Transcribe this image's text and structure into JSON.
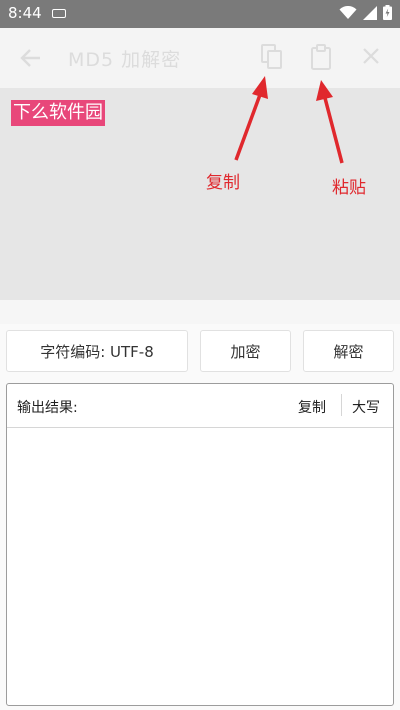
{
  "status_bar": {
    "time": "8:44",
    "icons": [
      "keyboard-icon",
      "wifi-icon",
      "signal-icon",
      "battery-charging-icon"
    ]
  },
  "app_bar": {
    "title": "MD5 加解密",
    "icons": [
      "back-arrow-icon",
      "copy-icon",
      "paste-icon",
      "close-icon"
    ]
  },
  "input": {
    "text": "下么软件园"
  },
  "buttons": {
    "encoding": "字符编码: UTF-8",
    "encrypt": "加密",
    "decrypt": "解密"
  },
  "output": {
    "label": "输出结果:",
    "copy": "复制",
    "uppercase": "大写",
    "value": ""
  },
  "annotations": {
    "copy": "复制",
    "paste": "粘贴"
  },
  "colors": {
    "highlight": "#e8477a",
    "annotation": "#e0282d",
    "status_bar": "#7a7a7a"
  }
}
